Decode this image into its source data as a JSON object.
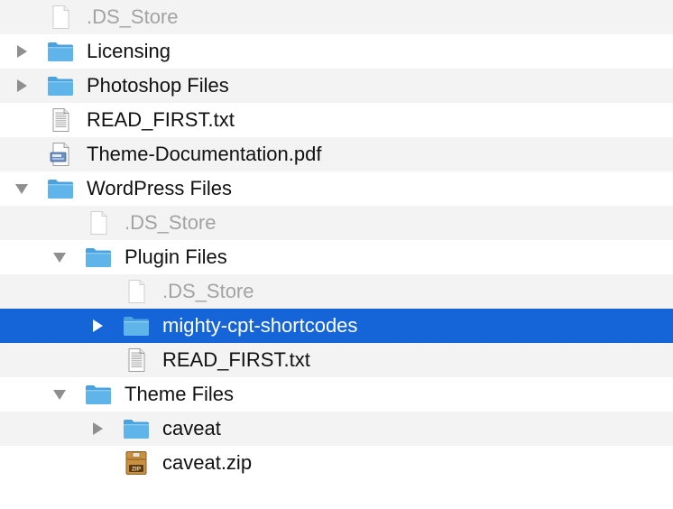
{
  "colors": {
    "selection": "#1665d8",
    "stripe": "#f3f3f3",
    "folder": "#5fb5ea",
    "text": "#111111",
    "dimmed_text": "#a3a3a3",
    "disclosure": "#8f8f8f"
  },
  "items": [
    {
      "name": ".DS_Store",
      "icon": "blank-document-icon",
      "disclosure": "none",
      "depth": 0,
      "dimmed": true,
      "selected": false
    },
    {
      "name": "Licensing",
      "icon": "folder-icon",
      "disclosure": "collapsed",
      "depth": 0,
      "dimmed": false,
      "selected": false
    },
    {
      "name": "Photoshop Files",
      "icon": "folder-icon",
      "disclosure": "collapsed",
      "depth": 0,
      "dimmed": false,
      "selected": false
    },
    {
      "name": "READ_FIRST.txt",
      "icon": "text-document-icon",
      "disclosure": "none",
      "depth": 0,
      "dimmed": false,
      "selected": false
    },
    {
      "name": "Theme-Documentation.pdf",
      "icon": "pdf-document-icon",
      "disclosure": "none",
      "depth": 0,
      "dimmed": false,
      "selected": false
    },
    {
      "name": "WordPress Files",
      "icon": "folder-icon",
      "disclosure": "expanded",
      "depth": 0,
      "dimmed": false,
      "selected": false
    },
    {
      "name": ".DS_Store",
      "icon": "blank-document-icon",
      "disclosure": "none",
      "depth": 1,
      "dimmed": true,
      "selected": false
    },
    {
      "name": "Plugin Files",
      "icon": "folder-icon",
      "disclosure": "expanded",
      "depth": 1,
      "dimmed": false,
      "selected": false
    },
    {
      "name": ".DS_Store",
      "icon": "blank-document-icon",
      "disclosure": "none",
      "depth": 2,
      "dimmed": true,
      "selected": false
    },
    {
      "name": "mighty-cpt-shortcodes",
      "icon": "folder-icon",
      "disclosure": "collapsed",
      "depth": 2,
      "dimmed": false,
      "selected": true
    },
    {
      "name": "READ_FIRST.txt",
      "icon": "text-document-icon",
      "disclosure": "none",
      "depth": 2,
      "dimmed": false,
      "selected": false
    },
    {
      "name": "Theme Files",
      "icon": "folder-icon",
      "disclosure": "expanded",
      "depth": 1,
      "dimmed": false,
      "selected": false
    },
    {
      "name": "caveat",
      "icon": "folder-icon",
      "disclosure": "collapsed",
      "depth": 2,
      "dimmed": false,
      "selected": false
    },
    {
      "name": "caveat.zip",
      "icon": "zip-archive-icon",
      "disclosure": "none",
      "depth": 2,
      "dimmed": false,
      "selected": false
    }
  ]
}
